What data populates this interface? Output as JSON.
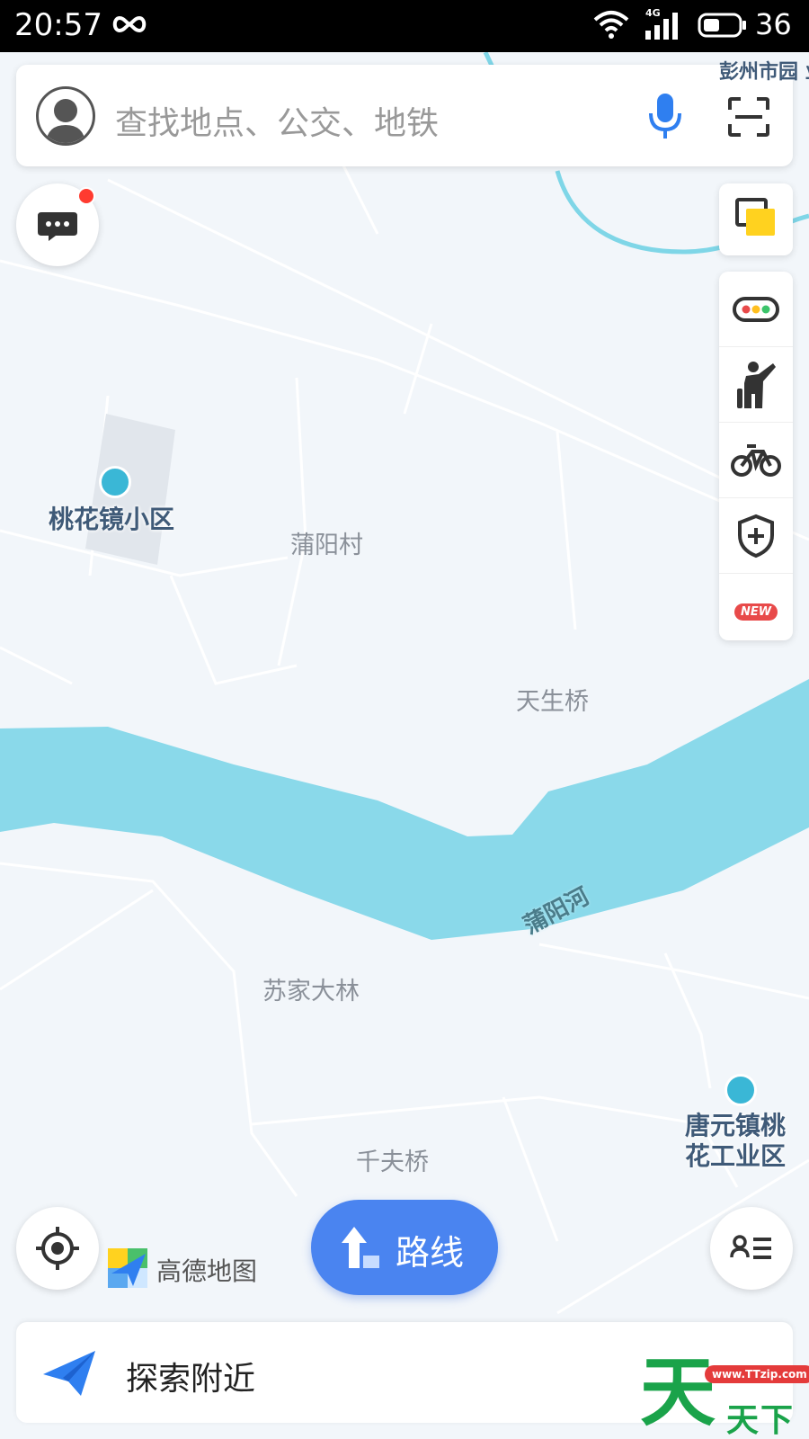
{
  "status_bar": {
    "time": "20:57",
    "network": "4G",
    "battery": "36"
  },
  "search": {
    "placeholder": "查找地点、公交、地铁"
  },
  "map": {
    "places": [
      "蒲阳村",
      "天生桥",
      "苏家大林",
      "千夫桥"
    ],
    "pois": [
      "桃花镜小区",
      "唐元镇桃",
      "花工业区"
    ],
    "river": "蒲阳河",
    "top_right_text": "彭州市园 业区"
  },
  "toolbar": {
    "new_badge": "NEW"
  },
  "brand": {
    "logo_text": "高德地图"
  },
  "route_button": {
    "label": "路线"
  },
  "explore": {
    "label": "探索附近"
  },
  "watermark": {
    "url": "www.TTzip.com",
    "big_char": "天",
    "text": "天下载"
  },
  "colors": {
    "accent_blue": "#4a84f0",
    "river": "#8ad9ea",
    "poi": "#3ab7d6",
    "alert_red": "#ff3b30",
    "traffic_yellow": "#ffd21f"
  }
}
